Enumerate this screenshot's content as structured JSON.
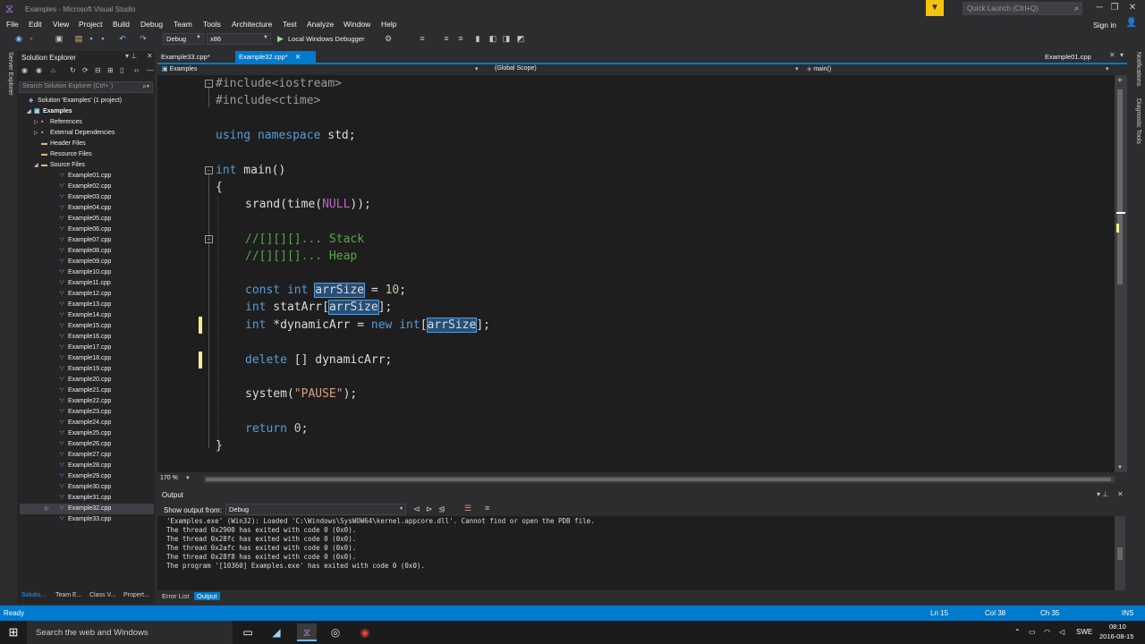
{
  "window": {
    "title": "Examples - Microsoft Visual Studio",
    "quick_launch_placeholder": "Quick Launch (Ctrl+Q)",
    "sign_in": "Sign in"
  },
  "menu": [
    "File",
    "Edit",
    "View",
    "Project",
    "Build",
    "Debug",
    "Team",
    "Tools",
    "Architecture",
    "Test",
    "Analyze",
    "Window",
    "Help"
  ],
  "toolbar": {
    "configuration": "Debug",
    "platform": "x86",
    "run_label": "Local Windows Debugger"
  },
  "left_strip": {
    "server_explorer": "Server Explorer"
  },
  "solution_explorer": {
    "title": "Solution Explorer",
    "search_placeholder": "Search Solution Explorer (Ctrl+`)",
    "solution": "Solution 'Examples' (1 project)",
    "project": "Examples",
    "nodes": [
      "References",
      "External Dependencies",
      "Header Files",
      "Resource Files",
      "Source Files"
    ],
    "files": [
      "Example01.cpp",
      "Example02.cpp",
      "Example03.cpp",
      "Example04.cpp",
      "Example05.cpp",
      "Example06.cpp",
      "Example07.cpp",
      "Example08.cpp",
      "Example09.cpp",
      "Example10.cpp",
      "Example11.cpp",
      "Example12.cpp",
      "Example13.cpp",
      "Example14.cpp",
      "Example15.cpp",
      "Example16.cpp",
      "Example17.cpp",
      "Example18.cpp",
      "Example19.cpp",
      "Example20.cpp",
      "Example21.cpp",
      "Example22.cpp",
      "Example23.cpp",
      "Example24.cpp",
      "Example25.cpp",
      "Example26.cpp",
      "Example27.cpp",
      "Example28.cpp",
      "Example29.cpp",
      "Example30.cpp",
      "Example31.cpp",
      "Example32.cpp",
      "Example33.cpp"
    ],
    "selected_file": "Example32.cpp",
    "bottom_tabs": [
      "Solutio...",
      "Team E...",
      "Class V...",
      "Propert..."
    ]
  },
  "doc_tabs": {
    "tabs": [
      "Example33.cpp*",
      "Example32.cpp*"
    ],
    "active": "Example32.cpp*",
    "preview_tab": "Example01.cpp"
  },
  "nav_bar": {
    "project": "Examples",
    "scope": "(Global Scope)",
    "member": "main()"
  },
  "editor": {
    "zoom": "170 %",
    "lines": {
      "l1": "#include<iostream>",
      "l2": "#include<ctime>",
      "l4a": "using",
      "l4b": "namespace",
      "l4c": " std;",
      "l6a": "int",
      "l6b": " main()",
      "l7": "{",
      "l8a": "srand(time(",
      "l8b": "NULL",
      "l8c": "));",
      "l10": "//[][][]... Stack",
      "l11": "//[][][]... Heap",
      "l13a": "const",
      "l13b": " ",
      "l13c": "int",
      "l13d": " ",
      "l13e": "arrSize",
      "l13f": " = ",
      "l13g": "10",
      "l13h": ";",
      "l14a": "int",
      "l14b": " statArr[",
      "l14c": "arrSize",
      "l14d": "];",
      "l15a": "int",
      "l15b": " *dynamicArr = ",
      "l15c": "new",
      "l15d": " ",
      "l15e": "int",
      "l15f": "[",
      "l15g": "arrSize",
      "l15h": "];",
      "l17a": "delete",
      "l17b": " [] dynamicArr;",
      "l19a": "system(",
      "l19b": "\"PAUSE\"",
      "l19c": ");",
      "l21a": "return",
      "l21b": " ",
      "l21c": "0",
      "l21d": ";",
      "l22": "}"
    }
  },
  "output": {
    "title": "Output",
    "show_from_label": "Show output from:",
    "source": "Debug",
    "lines": [
      "'Examples.exe' (Win32): Loaded 'C:\\Windows\\SysWOW64\\kernel.appcore.dll'. Cannot find or open the PDB file.",
      "The thread 0x2900 has exited with code 0 (0x0).",
      "The thread 0x28fc has exited with code 0 (0x0).",
      "The thread 0x2afc has exited with code 0 (0x0).",
      "The thread 0x28f8 has exited with code 0 (0x0).",
      "The program '[10360] Examples.exe' has exited with code 0 (0x0)."
    ],
    "tabs": [
      "Error List",
      "Output"
    ]
  },
  "right_strip": [
    "Notifications",
    "Diagnostic Tools"
  ],
  "status": {
    "ready": "Ready",
    "ln": "Ln 15",
    "col": "Col 38",
    "ch": "Ch 35",
    "ins": "INS"
  },
  "taskbar": {
    "search": "Search the web and Windows",
    "lang": "SWE",
    "time": "08:10",
    "date": "2016-08-15"
  },
  "colors": {
    "accent": "#007acc",
    "keyword": "#569cd6",
    "comment": "#57a64a",
    "string": "#d69d85",
    "number": "#b5cea8",
    "macro": "#bd63c5",
    "change_marker": "#efef91"
  }
}
